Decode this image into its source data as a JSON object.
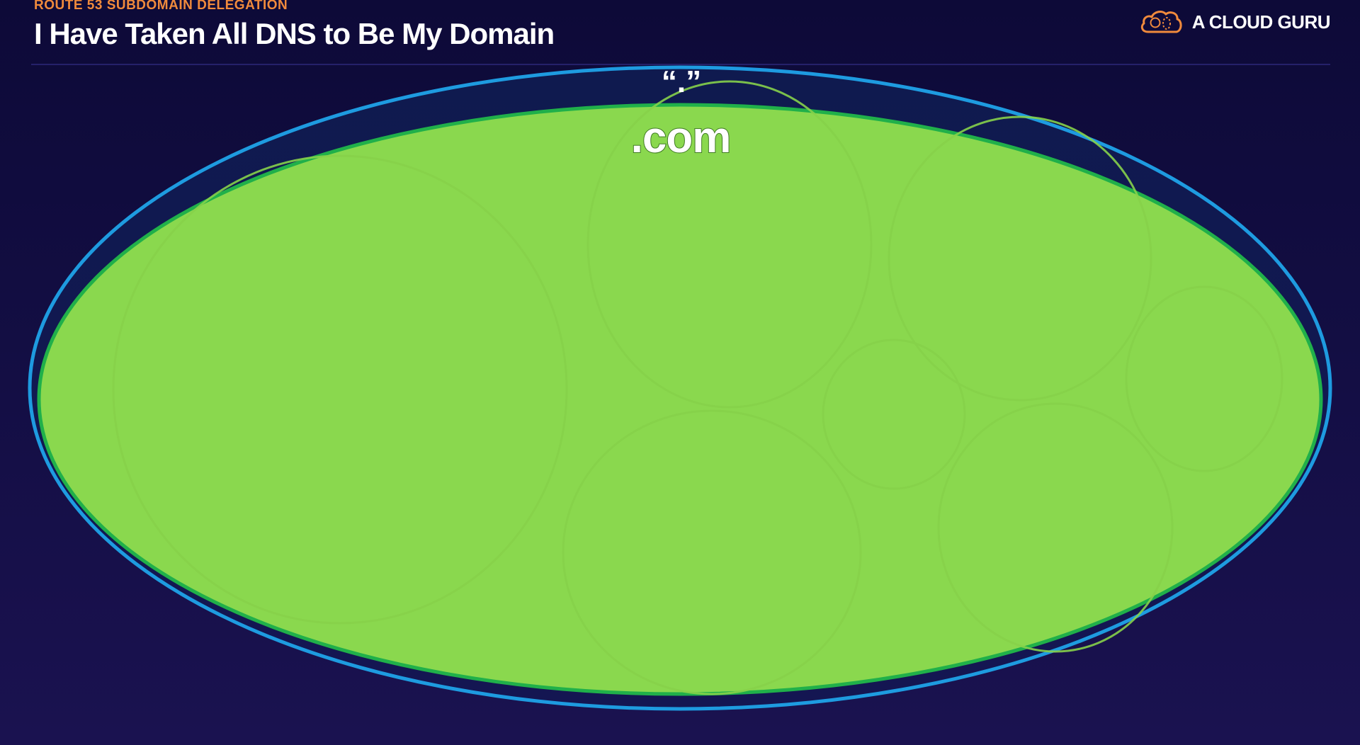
{
  "header": {
    "eyebrow": "ROUTE 53 SUBDOMAIN DELEGATION",
    "title": "I Have Taken All DNS to Be My Domain"
  },
  "brand": {
    "name": "A CLOUD GURU",
    "icon": "cloud-logo-icon"
  },
  "diagram": {
    "root_label": "“.”",
    "tld_label": ".com"
  },
  "colors": {
    "background": "#130e45",
    "accent": "#f08a3c",
    "root_ring": "#1e9be0",
    "root_fill": "#10184d",
    "tld_ring": "#20b04a",
    "tld_fill": "#8ad84e"
  }
}
